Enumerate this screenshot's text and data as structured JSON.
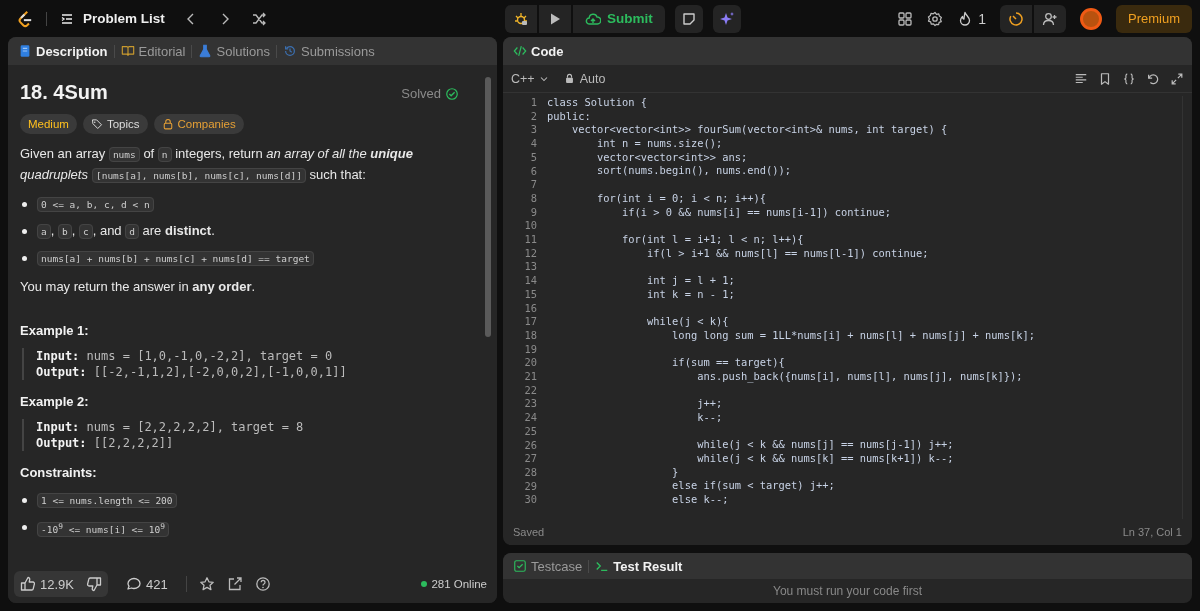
{
  "top_bar": {
    "problem_list": "Problem List",
    "submit": "Submit",
    "streak": "1",
    "premium": "Premium"
  },
  "description_panel": {
    "tabs": [
      {
        "label": "Description",
        "selected": true
      },
      {
        "label": "Editorial",
        "selected": false
      },
      {
        "label": "Solutions",
        "selected": false
      },
      {
        "label": "Submissions",
        "selected": false
      }
    ],
    "title": "18. 4Sum",
    "status": "Solved",
    "tags": [
      {
        "label": "Medium",
        "kind": "difficulty"
      },
      {
        "label": "Topics",
        "kind": "topics"
      },
      {
        "label": "Companies",
        "kind": "companies"
      }
    ],
    "blocks": [
      {
        "kind": "para",
        "segments": [
          {
            "kind": "text",
            "text": "Given an array "
          },
          {
            "kind": "code",
            "text": "nums"
          },
          {
            "kind": "text",
            "text": " of "
          },
          {
            "kind": "code",
            "text": "n"
          },
          {
            "kind": "text",
            "text": " integers, return "
          },
          {
            "kind": "emph",
            "text": "an array of all the **unique** quadruplets"
          },
          {
            "kind": "code",
            "text": "[nums[a], nums[b], nums[c], nums[d]]"
          },
          {
            "kind": "text",
            "text": " such that:"
          }
        ]
      },
      {
        "kind": "bullet",
        "segments": [
          {
            "kind": "code",
            "text": "0 <= a, b, c, d < n"
          }
        ]
      },
      {
        "kind": "bullet",
        "segments": [
          {
            "kind": "code",
            "text": "a"
          },
          {
            "kind": "text",
            "text": ", "
          },
          {
            "kind": "code",
            "text": "b"
          },
          {
            "kind": "text",
            "text": ", "
          },
          {
            "kind": "code",
            "text": "c"
          },
          {
            "kind": "text",
            "text": ", and "
          },
          {
            "kind": "code",
            "text": "d"
          },
          {
            "kind": "text",
            "text": " are **distinct**."
          }
        ]
      },
      {
        "kind": "bullet",
        "segments": [
          {
            "kind": "code",
            "text": "nums[a] + nums[b] + nums[c] + nums[d] == target"
          }
        ]
      },
      {
        "kind": "para",
        "segments": [
          {
            "kind": "text",
            "text": "You may return the answer in **any order**."
          }
        ]
      },
      {
        "kind": "heading",
        "text": "Example 1:"
      },
      {
        "kind": "example",
        "lines": [
          {
            "label": "Input:",
            "value": "nums = [1,0,-1,0,-2,2], target = 0"
          },
          {
            "label": "Output:",
            "value": "[[-2,-1,1,2],[-2,0,0,2],[-1,0,0,1]]"
          }
        ]
      },
      {
        "kind": "heading",
        "text": "Example 2:"
      },
      {
        "kind": "example",
        "lines": [
          {
            "label": "Input:",
            "value": "nums = [2,2,2,2,2], target = 8"
          },
          {
            "label": "Output:",
            "value": "[[2,2,2,2]]"
          }
        ]
      },
      {
        "kind": "heading",
        "text": "Constraints:"
      },
      {
        "kind": "bullet",
        "segments": [
          {
            "kind": "code",
            "text": "1 <= nums.length <= 200"
          }
        ]
      },
      {
        "kind": "bullet",
        "segments": [
          {
            "kind": "code",
            "text": "-10$^{9}$ <= nums[i] <= 10$^{9}$"
          }
        ]
      }
    ],
    "footer": {
      "likes": "12.9K",
      "comments": "421",
      "online": "281 Online"
    }
  },
  "code_panel": {
    "title": "Code",
    "language": "C++",
    "mode": "Auto",
    "lines": [
      {
        "n": "1",
        "code": "class Solution {"
      },
      {
        "n": "2",
        "code": "public:"
      },
      {
        "n": "3",
        "code": "    vector<vector<int>> fourSum(vector<int>& nums, int target) {"
      },
      {
        "n": "4",
        "code": "        int n = nums.size();"
      },
      {
        "n": "5",
        "code": "        vector<vector<int>> ans;"
      },
      {
        "n": "6",
        "code": "        sort(nums.begin(), nums.end());"
      },
      {
        "n": "7"
      },
      {
        "n": "8",
        "code": "        for(int i = 0; i < n; i++){"
      },
      {
        "n": "9",
        "code": "            if(i > 0 && nums[i] == nums[i-1]) continue;"
      },
      {
        "n": "10"
      },
      {
        "n": "11",
        "code": "            for(int l = i+1; l < n; l++){"
      },
      {
        "n": "12",
        "code": "                if(l > i+1 && nums[l] == nums[l-1]) continue;"
      },
      {
        "n": "13"
      },
      {
        "n": "14",
        "code": "                int j = l + 1;"
      },
      {
        "n": "15",
        "code": "                int k = n - 1;"
      },
      {
        "n": "16"
      },
      {
        "n": "17",
        "code": "                while(j < k){"
      },
      {
        "n": "18",
        "code": "                    long long sum = 1LL*nums[i] + nums[l] + nums[j] + nums[k];"
      },
      {
        "n": "19"
      },
      {
        "n": "20",
        "code": "                    if(sum == target){"
      },
      {
        "n": "21",
        "code": "                        ans.push_back({nums[i], nums[l], nums[j], nums[k]});"
      },
      {
        "n": "22"
      },
      {
        "n": "23",
        "code": "                        j++;"
      },
      {
        "n": "24",
        "code": "                        k--;"
      },
      {
        "n": "25"
      },
      {
        "n": "26",
        "code": "                        while(j < k && nums[j] == nums[j-1]) j++;"
      },
      {
        "n": "27",
        "code": "                        while(j < k && nums[k] == nums[k+1]) k--;"
      },
      {
        "n": "28",
        "code": "                    }"
      },
      {
        "n": "29",
        "code": "                    else if(sum < target) j++;"
      },
      {
        "n": "30",
        "code": "                    else k--;"
      }
    ],
    "status": "Saved",
    "cursor": "Ln 37, Col 1"
  },
  "result_panel": {
    "tabs": [
      {
        "label": "Testcase",
        "selected": false
      },
      {
        "label": "Test Result",
        "selected": true
      }
    ],
    "message": "You must run your code first"
  }
}
